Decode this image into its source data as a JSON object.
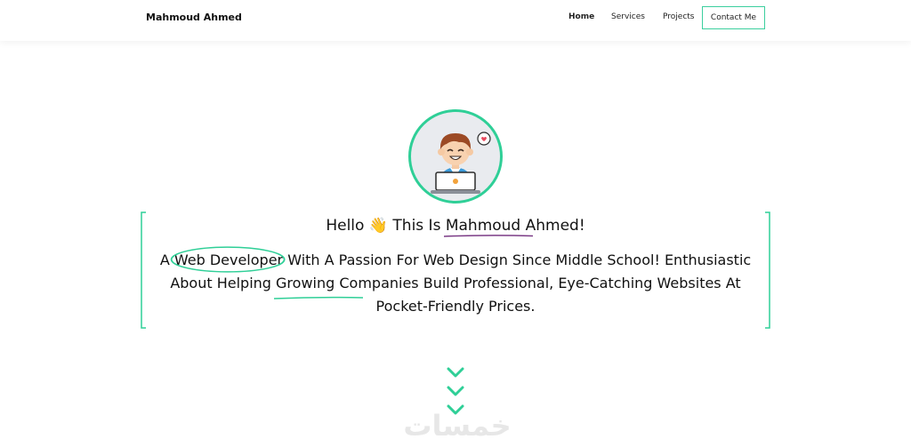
{
  "header": {
    "brand": "Mahmoud Ahmed",
    "nav": [
      "Home",
      "Services",
      "Projects"
    ],
    "contact_label": "Contact Me"
  },
  "hero": {
    "hello_prefix": "Hello",
    "wave_emoji": "👋",
    "hello_middle": "This Is",
    "name": "Mahmoud Ahmed!",
    "intro_a": "A",
    "role": "Web Developer",
    "intro_b": "With A Passion For Web Design Since Middle School! Enthusiastic About Helping",
    "highlight": "Growing Companies",
    "intro_c": "Build Professional, Eye-Catching Websites At Pocket-Friendly Prices."
  },
  "watermark": "خمسات",
  "colors": {
    "accent": "#2fcf97",
    "name_underline": "#7b3b86"
  },
  "icons": [
    "avatar-illustration",
    "scroll-down-chevron-icon"
  ]
}
